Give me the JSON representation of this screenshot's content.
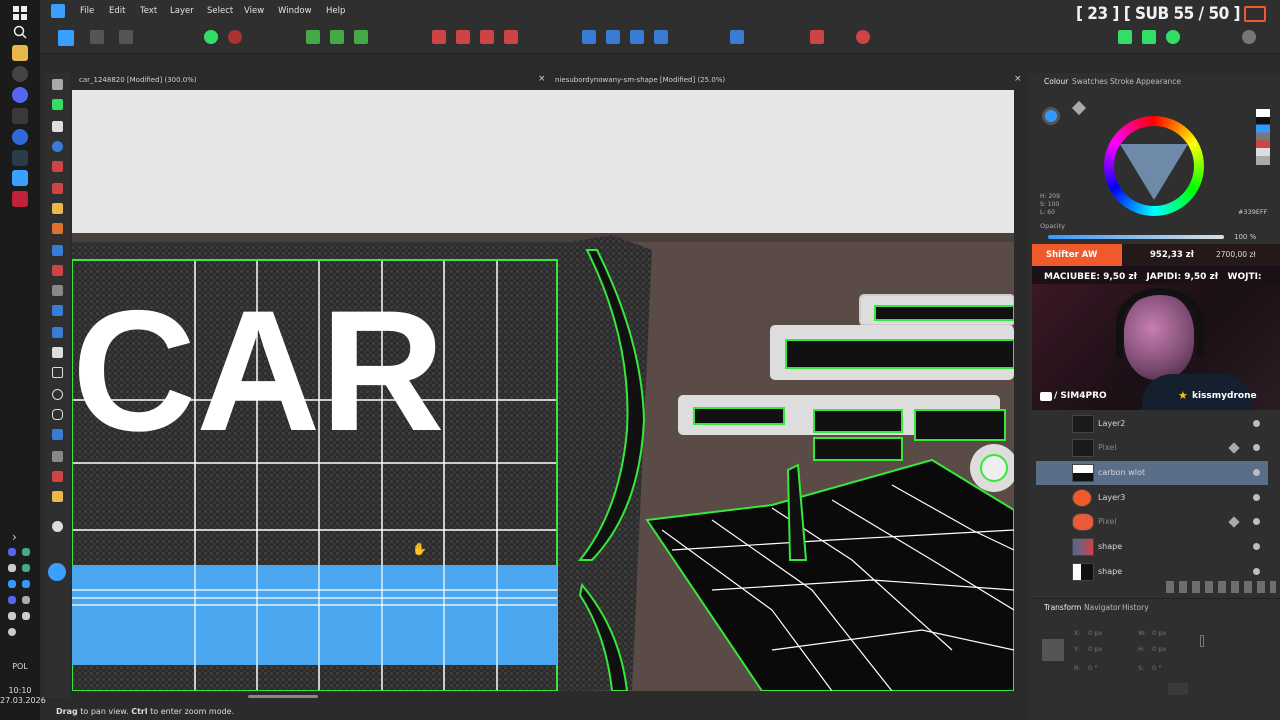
{
  "menu": {
    "items": [
      "File",
      "Edit",
      "Text",
      "Layer",
      "Select",
      "View",
      "Window",
      "Help"
    ]
  },
  "overlay": {
    "counter": "[ 23 ]   [ SUB 55 / 50 ]"
  },
  "documents": {
    "tab1": "car_1248820 [Modified] (300.0%)",
    "tab2": "niesubordynowany-sm-shape [Modified] (25.0%)",
    "close": "×"
  },
  "canvas": {
    "text": "CAR"
  },
  "colour_panel": {
    "tabs": [
      "Colour",
      "Swatches",
      "Stroke",
      "Appearance"
    ],
    "hsl": {
      "h": "H: 209",
      "s": "S: 100",
      "l": "L: 60"
    },
    "hex": "339EFF",
    "opacity_label": "Opacity",
    "opacity_value": "100 %"
  },
  "stream": {
    "donor": "Shifter AW",
    "amount1": "952,33 zł",
    "amount2": "2700,00 zł",
    "ticker": "MACIUBEE: 9,50 zł   JAPIDI: 9,50 zł   WOJTI:",
    "channel": "/ SIM4PRO",
    "user": "kissmydrone"
  },
  "layers": [
    {
      "name": "Layer2",
      "selected": false
    },
    {
      "name": "Pixel",
      "selected": false,
      "dim": true
    },
    {
      "name": "carbon wlot",
      "selected": true
    },
    {
      "name": "Layer3",
      "selected": false
    },
    {
      "name": "Pixel",
      "selected": false,
      "dim": true
    },
    {
      "name": "shape",
      "selected": false
    },
    {
      "name": "shape",
      "selected": false
    }
  ],
  "transform_panel": {
    "tabs": [
      "Transform",
      "Navigator",
      "History"
    ],
    "x": "0 px",
    "y": "0 px",
    "w": "0 px",
    "h": "0 px",
    "r": "0 °",
    "s": "0 °",
    "labels": {
      "x": "X:",
      "y": "Y:",
      "w": "W:",
      "h": "H:",
      "r": "R:",
      "s": "S:"
    }
  },
  "status": {
    "drag": "Drag",
    "text1": " to pan view. ",
    "ctrl": "Ctrl",
    "text2": " to enter zoom mode."
  },
  "system": {
    "time": "10:10",
    "date": "27.03.2026",
    "lang": "POL"
  },
  "colors": {
    "accent": "#339EFF",
    "green": "#35e83a",
    "orange": "#f05a2a",
    "selected": "#5a6e8a"
  }
}
